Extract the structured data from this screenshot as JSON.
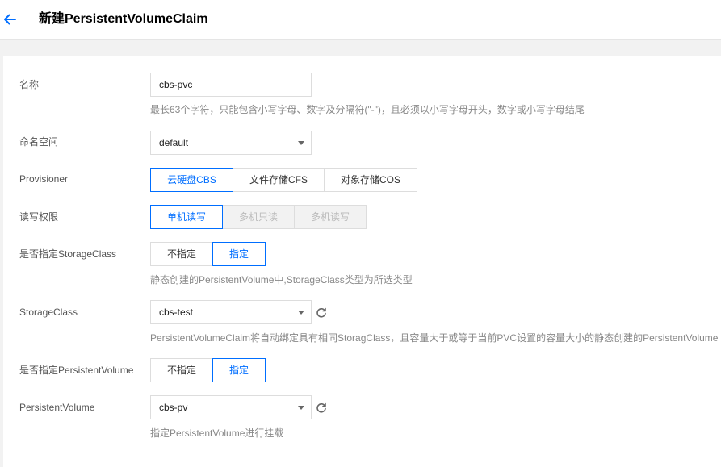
{
  "header": {
    "title": "新建PersistentVolumeClaim"
  },
  "form": {
    "name": {
      "label": "名称",
      "value": "cbs-pvc",
      "hint": "最长63个字符，只能包含小写字母、数字及分隔符(\"-\")，且必须以小写字母开头，数字或小写字母结尾"
    },
    "namespace": {
      "label": "命名空间",
      "value": "default"
    },
    "provisioner": {
      "label": "Provisioner",
      "options": [
        "云硬盘CBS",
        "文件存储CFS",
        "对象存储COS"
      ],
      "selected": "云硬盘CBS"
    },
    "access": {
      "label": "读写权限",
      "options": [
        "单机读写",
        "多机只读",
        "多机读写"
      ],
      "selected": "单机读写"
    },
    "specify_storageclass": {
      "label": "是否指定StorageClass",
      "options": [
        "不指定",
        "指定"
      ],
      "selected": "指定",
      "hint": "静态创建的PersistentVolume中,StorageClass类型为所选类型"
    },
    "storageclass": {
      "label": "StorageClass",
      "value": "cbs-test",
      "hint": "PersistentVolumeClaim将自动绑定具有相同StoragClass，且容量大于或等于当前PVC设置的容量大小的静态创建的PersistentVolume"
    },
    "specify_pv": {
      "label": "是否指定PersistentVolume",
      "options": [
        "不指定",
        "指定"
      ],
      "selected": "指定"
    },
    "pv": {
      "label": "PersistentVolume",
      "value": "cbs-pv",
      "hint": "指定PersistentVolume进行挂载"
    }
  },
  "colors": {
    "accent": "#006eff",
    "disabled_bg": "#f2f2f2"
  },
  "icons": {
    "back": "arrow-left-icon",
    "refresh": "refresh-icon",
    "dropdown": "chevron-down-icon"
  }
}
